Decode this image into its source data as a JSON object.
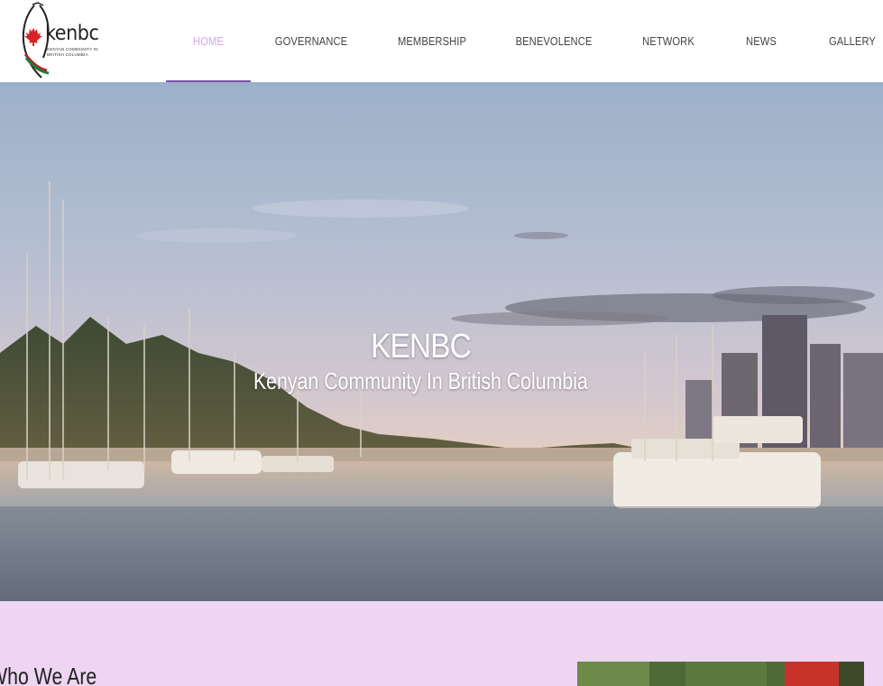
{
  "header": {
    "logo": {
      "wordmark": "kenbc",
      "tagline": "KENYAN COMMUNITY IN BRITISH COLUMBIA",
      "icon": "maple-leaf-shield-icon"
    },
    "nav": [
      {
        "label": "HOME",
        "active": true
      },
      {
        "label": "GOVERNANCE",
        "active": false
      },
      {
        "label": "MEMBERSHIP",
        "active": false
      },
      {
        "label": "BENEVOLENCE",
        "active": false
      },
      {
        "label": "NETWORK",
        "active": false
      },
      {
        "label": "NEWS",
        "active": false
      },
      {
        "label": "GALLERY",
        "active": false
      }
    ]
  },
  "hero": {
    "title": "KENBC",
    "subtitle": "Kenyan Community In British Columbia"
  },
  "about": {
    "heading": "Who We Are"
  },
  "colors": {
    "nav_active": "#d9a7e6",
    "nav_underline": "#7b4fa8",
    "section_background": "#eed5f2",
    "text_dark": "#222222"
  }
}
